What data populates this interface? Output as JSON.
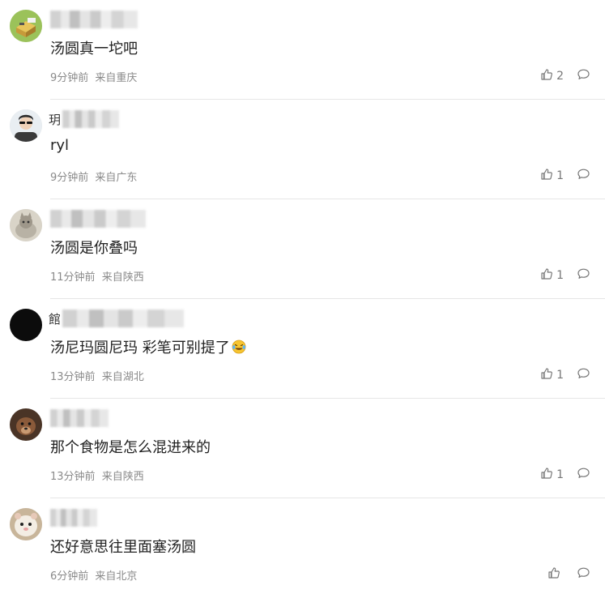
{
  "comments": [
    {
      "name_char": "",
      "text": "汤圆真一坨吧",
      "time": "9分钟前",
      "location": "来自重庆",
      "likes": "2",
      "avatar": "avatar-box",
      "blur_width": 108
    },
    {
      "name_char": "玥",
      "text": "ryl",
      "time": "9分钟前",
      "location": "来自广东",
      "likes": "1",
      "avatar": "avatar-sunglasses",
      "blur_width": 70
    },
    {
      "name_char": "",
      "text": "汤圆是你叠吗",
      "time": "11分钟前",
      "location": "来自陕西",
      "likes": "1",
      "avatar": "avatar-cat-grey",
      "blur_width": 118
    },
    {
      "name_char": "館",
      "text": "汤尼玛圆尼玛 彩笔可别提了",
      "time": "13分钟前",
      "location": "来自湖北",
      "likes": "1",
      "avatar": "avatar-black",
      "blur_width": 150,
      "emoji": "laughing-crying-emoji"
    },
    {
      "name_char": "",
      "text": "那个食物是怎么混进来的",
      "time": "13分钟前",
      "location": "来自陕西",
      "likes": "1",
      "avatar": "avatar-dog",
      "blur_width": 72
    },
    {
      "name_char": "",
      "text": "还好意思往里面塞汤圆",
      "time": "6分钟前",
      "location": "来自北京",
      "likes": "",
      "avatar": "avatar-hamster",
      "blur_width": 58
    }
  ]
}
